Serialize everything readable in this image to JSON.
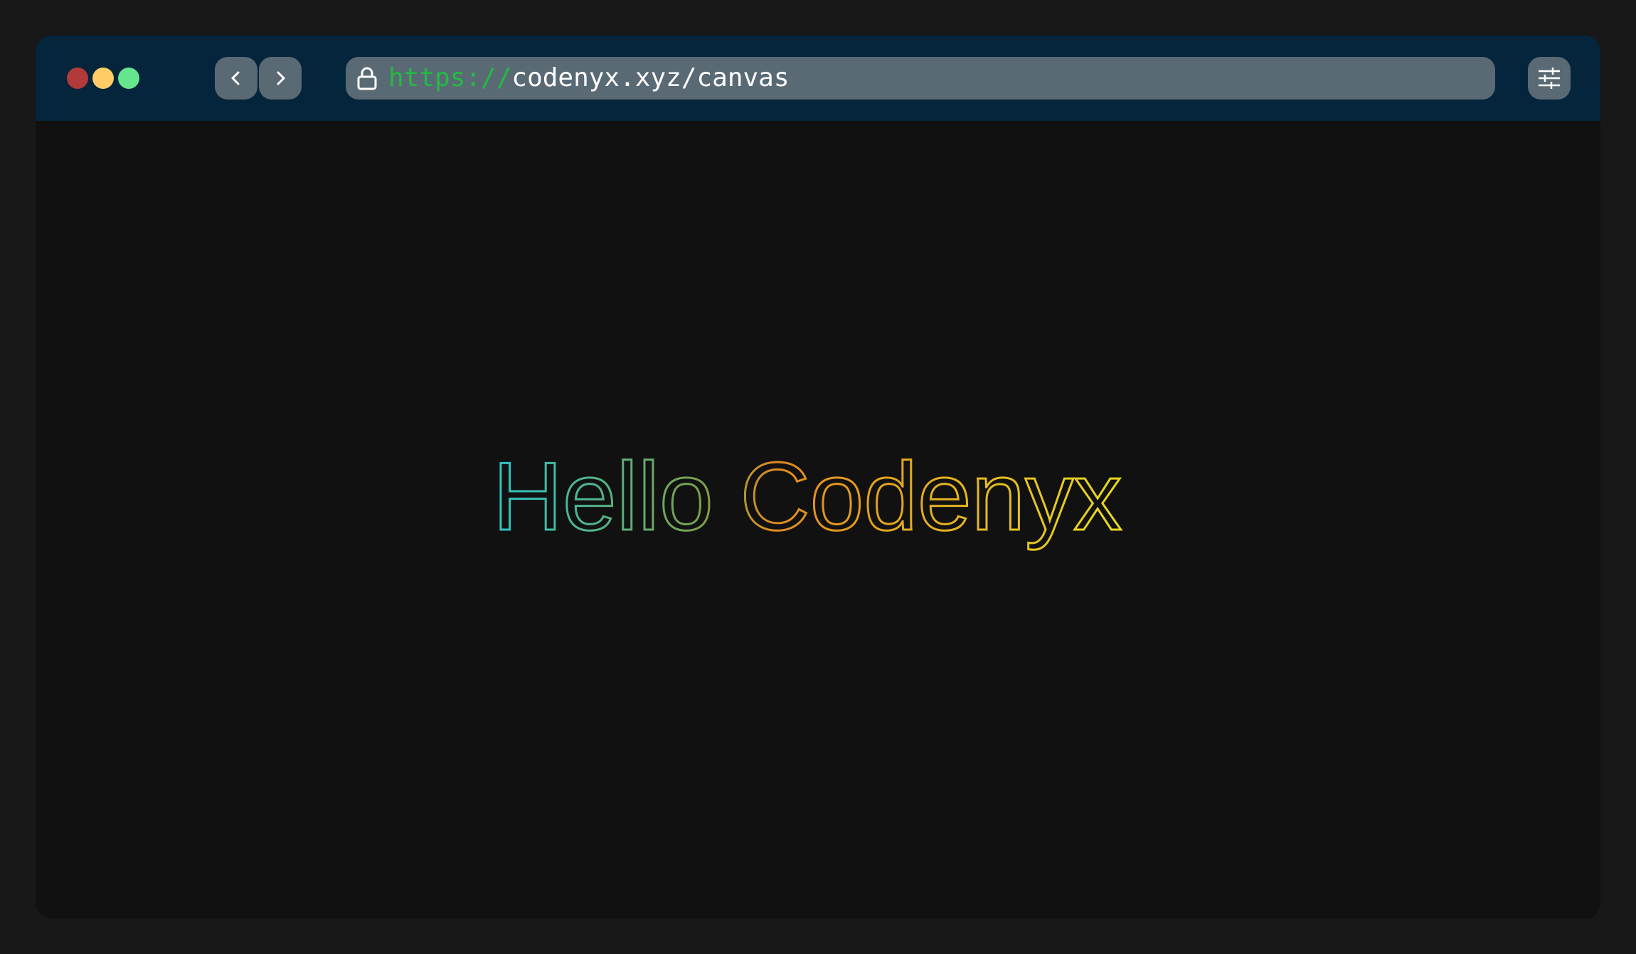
{
  "browser": {
    "window_controls": [
      "close",
      "minimize",
      "maximize"
    ],
    "nav": {
      "back_icon": "chevron-left-icon",
      "forward_icon": "chevron-right-icon"
    },
    "address_bar": {
      "lock_icon": "lock-icon",
      "scheme": "https://",
      "rest": "codenyx.xyz/canvas"
    },
    "settings_icon": "sliders-icon"
  },
  "canvas": {
    "text": "Hello Codenyx",
    "gradient": [
      "#2ec4c4",
      "#7aa04a",
      "#e08a20",
      "#e8d820"
    ]
  },
  "colors": {
    "titlebar": "#04253b",
    "control_bg": "#5a6a75",
    "scheme_green": "#22bb44",
    "page_bg": "#111111"
  }
}
